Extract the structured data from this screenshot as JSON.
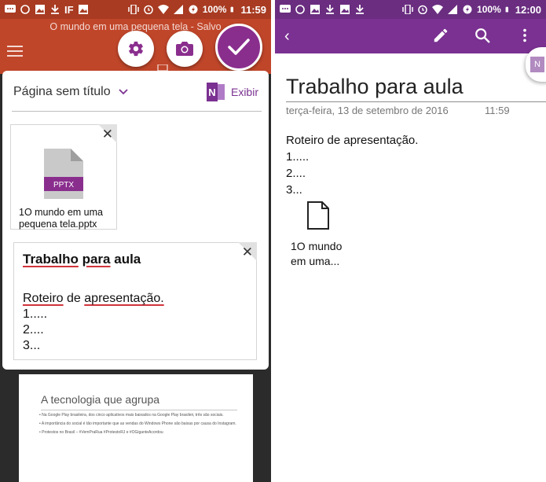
{
  "left": {
    "status": {
      "battery": "100%",
      "time": "11:59",
      "if_label": "IF"
    },
    "app_title": "O mundo em uma pequena tela - Salvo",
    "page_name": "Página sem título",
    "onenote_label": "Exibir",
    "attachment": {
      "badge": "PPTX",
      "name": "1O mundo em uma pequena tela.pptx"
    },
    "note": {
      "title_words": [
        "Trabalho",
        "para",
        "aula"
      ],
      "line1_a": "Roteiro",
      "line1_b": "de",
      "line1_c": "apresentação.",
      "lines": [
        "1.....",
        "2....",
        "3..."
      ]
    },
    "slide": {
      "title": "A tecnologia que agrupa",
      "bullets": [
        "• Na Google Play brasileira, dos cinco aplicativos mais baixados na Google Play brasileir, três são sociais.",
        "• A importância do social é tão importante que as vendas do Windows Phone são baixas por causa do Instagram.",
        "• Protestos no Brasil – #VemPraRua #ProtestoRJ e #OGiganteAcordou"
      ]
    }
  },
  "right": {
    "status": {
      "battery": "100%",
      "time": "12:00"
    },
    "tab_letter": "N",
    "title": "Trabalho para aula",
    "date": "terça-feira, 13 de setembro de 2016",
    "time": "11:59",
    "body": [
      "Roteiro de apresentação.",
      "1.....",
      "2....",
      "3..."
    ],
    "file_name": [
      "1O mundo",
      "em uma..."
    ]
  },
  "colors": {
    "left_appbar": "#c0462a",
    "left_statusbar": "#a83b22",
    "right_appbar": "#7a3191",
    "right_statusbar": "#6a2d80",
    "onenote_purple": "#7a3191",
    "spell_red": "#d0343c"
  },
  "icons": [
    "message-icon",
    "whatsapp-icon",
    "image-icon",
    "download-icon",
    "flipboard-icon",
    "vibrate-icon",
    "alarm-icon",
    "wifi-icon",
    "signal-icon",
    "battery-saver-icon",
    "hamburger-icon",
    "gear-icon",
    "camera-icon",
    "check-icon",
    "chevron-down-icon",
    "onenote-icon",
    "close-icon",
    "file-icon",
    "back-icon",
    "pencil-icon",
    "search-icon",
    "more-vert-icon"
  ]
}
